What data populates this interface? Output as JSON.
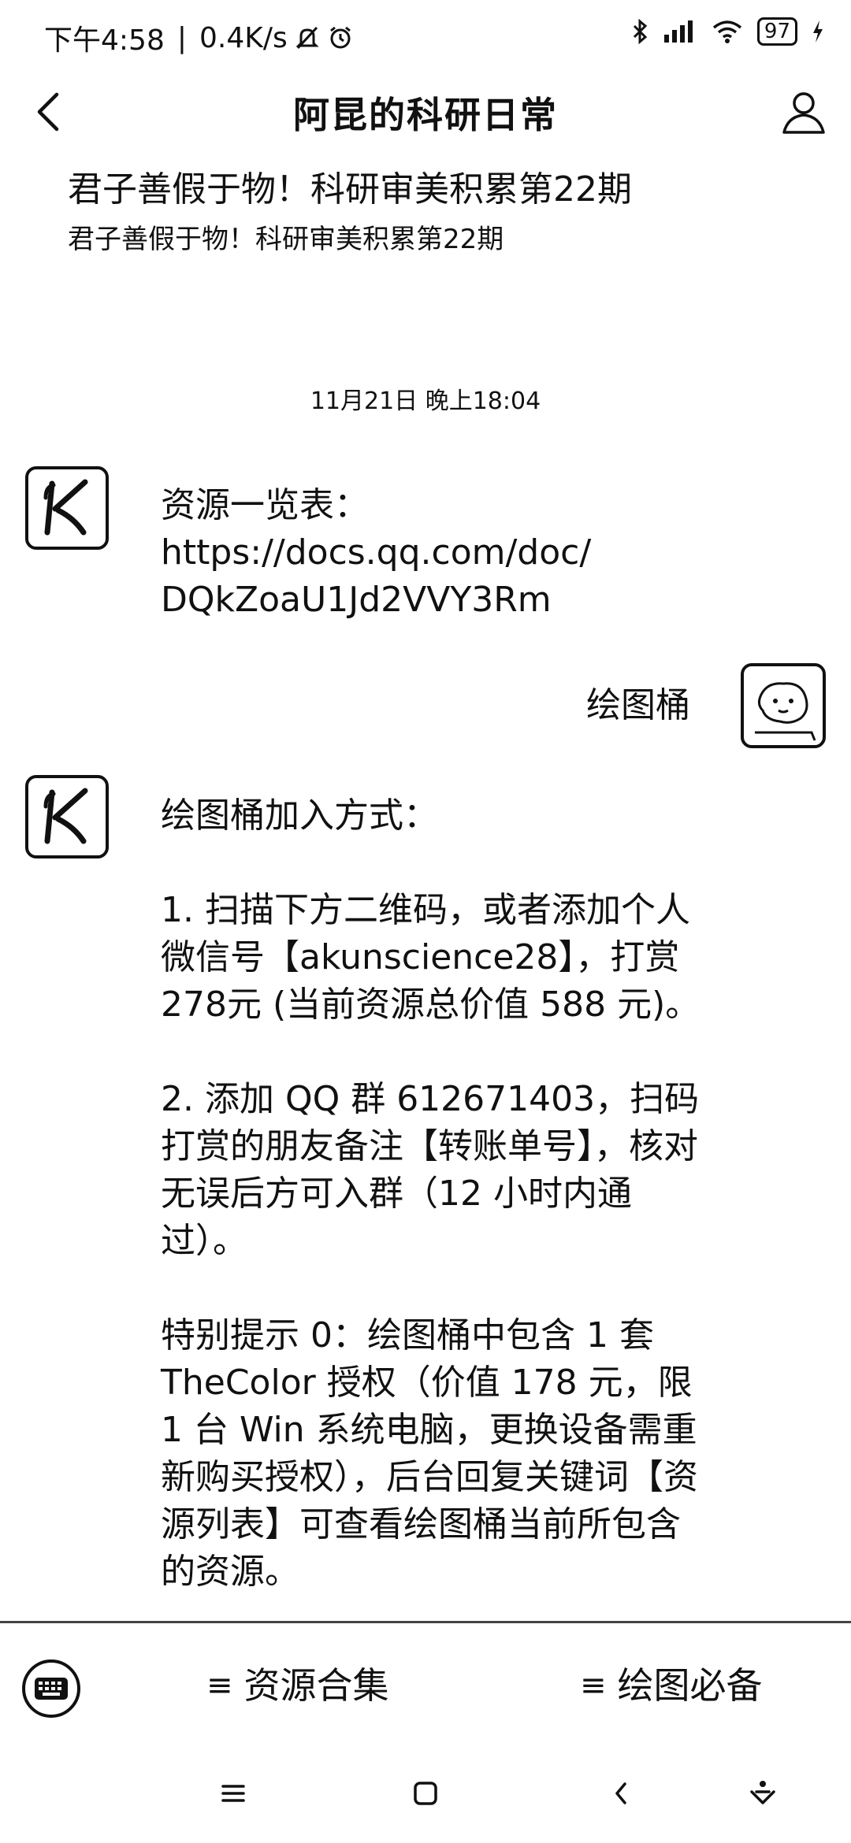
{
  "status": {
    "time": "下午4:58",
    "speed": "0.4K/s",
    "battery": "97"
  },
  "nav": {
    "title": "阿昆的科研日常"
  },
  "article": {
    "title": "君子善假于物！科研审美积累第22期",
    "subtitle": "君子善假于物！科研审美积累第22期"
  },
  "timestamp": "11月21日 晚上18:04",
  "messages": {
    "m1": {
      "line1": "资源一览表：",
      "line2": "https://docs.qq.com/doc/",
      "line3": "DQkZoaU1Jd2VVY3Rm"
    },
    "m2": {
      "text": "绘图桶"
    },
    "m3": {
      "p1": "绘图桶加入方式：",
      "p2": "1. 扫描下方二维码，或者添加个人微信号【akunscience28】，打赏278元 (当前资源总价值 588 元)。",
      "p3": "2. 添加 QQ 群 612671403，扫码打赏的朋友备注【转账单号】，核对无误后方可入群（12 小时内通过）。",
      "p4": "特别提示 0：绘图桶中包含 1 套 TheColor 授权（价值 178 元，限 1 台 Win 系统电脑，更换设备需重新购买授权），后台回复关键词【资源列表】可查看绘图桶当前所包含的资源。"
    }
  },
  "menu": {
    "item1": "资源合集",
    "item2": "绘图必备"
  },
  "icons": {
    "back": "chevron-left-icon",
    "profile": "person-icon",
    "keyboard": "keyboard-icon",
    "menu_lines": "menu-lines-icon"
  }
}
